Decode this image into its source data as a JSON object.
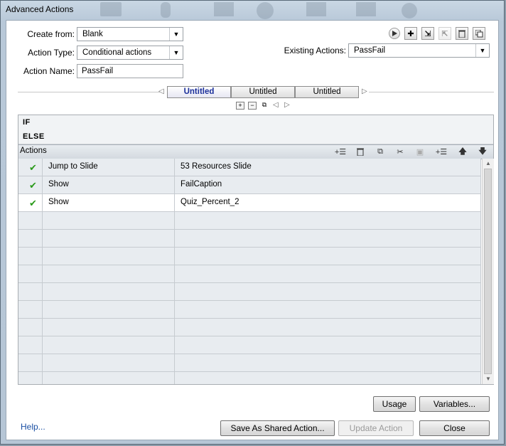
{
  "window": {
    "title": "Advanced Actions"
  },
  "form": {
    "create_from_label": "Create from:",
    "create_from_value": "Blank",
    "action_type_label": "Action Type:",
    "action_type_value": "Conditional actions",
    "action_name_label": "Action Name:",
    "action_name_value": "PassFail",
    "existing_actions_label": "Existing Actions:",
    "existing_actions_value": "PassFail"
  },
  "toolbar": {
    "icons": [
      "preview-icon",
      "add-icon",
      "import-icon",
      "export-icon",
      "delete-icon",
      "duplicate-icon"
    ]
  },
  "tabs": [
    {
      "label": "Untitled",
      "active": true
    },
    {
      "label": "Untitled",
      "active": false
    },
    {
      "label": "Untitled",
      "active": false
    }
  ],
  "sections": {
    "if_label": "IF",
    "else_label": "ELSE"
  },
  "actions": {
    "header": "Actions",
    "buttons": [
      "insert-icon",
      "delete-icon",
      "copy-icon",
      "cut-icon",
      "paste-icon",
      "insert-below-icon",
      "move-up-icon",
      "move-down-icon"
    ],
    "rows": [
      {
        "checked": true,
        "action": "Jump to Slide",
        "target": "53 Resources Slide",
        "selected": false
      },
      {
        "checked": true,
        "action": "Show",
        "target": "FailCaption",
        "selected": false
      },
      {
        "checked": true,
        "action": "Show",
        "target": "Quiz_Percent_2",
        "selected": true
      }
    ],
    "empty_rows": 10
  },
  "buttons": {
    "usage": "Usage",
    "variables": "Variables...",
    "save_shared": "Save As Shared Action...",
    "update": "Update Action",
    "close": "Close"
  },
  "help_link": "Help..."
}
